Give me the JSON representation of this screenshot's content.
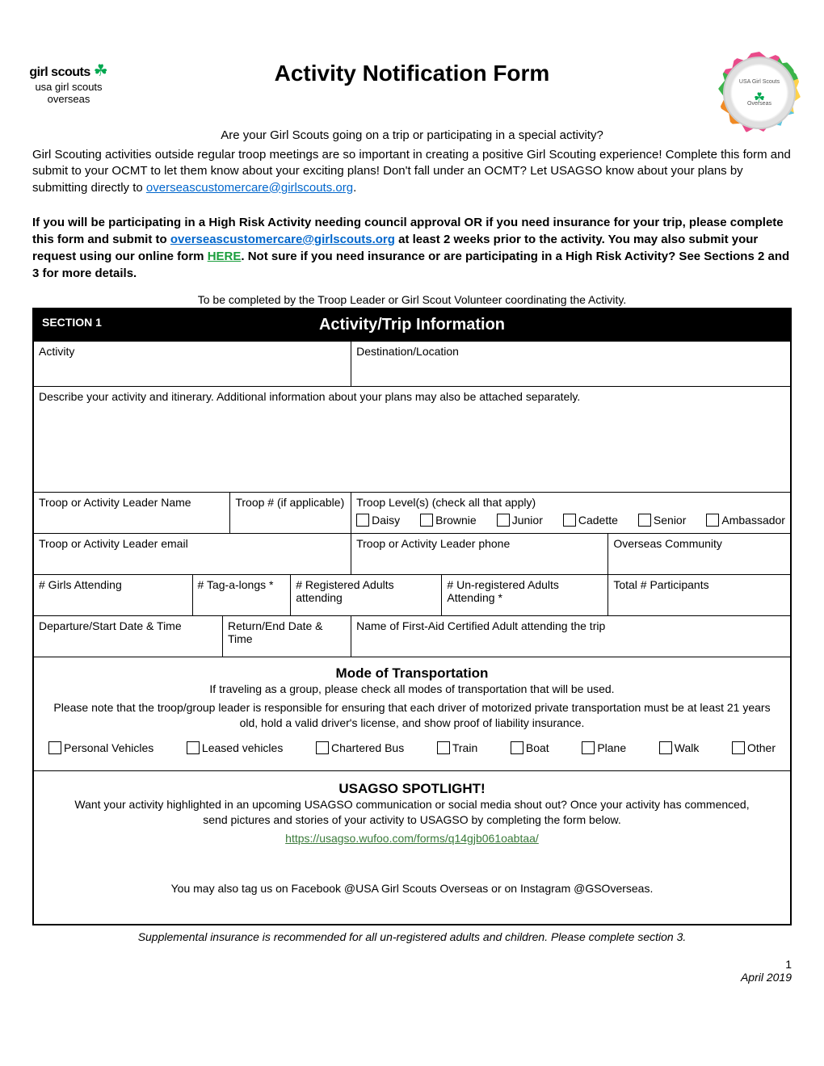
{
  "logo": {
    "line1": "girl scouts",
    "line2": "usa girl scouts",
    "line3": "overseas"
  },
  "badge": {
    "top": "USA Girl Scouts",
    "bottom": "Overseas"
  },
  "title": "Activity Notification Form",
  "subtitle": "Are your Girl Scouts going on a trip or participating in a special activity?",
  "intro": {
    "p1": "Girl Scouting activities outside regular troop meetings are so important in creating a positive Girl Scouting experience!  Complete this form and submit to your OCMT to let them know about your exciting plans!  Don't fall under an OCMT?  Let USAGSO know about your plans by submitting directly to ",
    "email": "overseascustomercare@girlscouts.org",
    "p1_end": "."
  },
  "bold": {
    "a": "If you will be participating in a High Risk Activity needing council approval OR if you need insurance for your trip, please complete this form and submit to ",
    "email": "overseascustomercare@girlscouts.org",
    "b": " at least 2 weeks prior to the activity.  You may also submit your request using our online form ",
    "here": "HERE",
    "c": ".  Not sure if you need insurance or are participating in a High Risk Activity?  See Sections 2 and 3 for more details."
  },
  "completed_by": "To be completed by the Troop Leader or Girl Scout Volunteer coordinating the Activity.",
  "section1": {
    "label": "SECTION 1",
    "title": "Activity/Trip Information",
    "activity": "Activity",
    "destination": "Destination/Location",
    "describe": "Describe your activity and itinerary.  Additional information about your plans may also be attached separately.",
    "leader_name": "Troop or Activity Leader Name",
    "troop_num": "Troop # (if applicable)",
    "troop_level": "Troop Level(s) (check all that apply)",
    "levels": [
      "Daisy",
      "Brownie",
      "Junior",
      "Cadette",
      "Senior",
      "Ambassador"
    ],
    "leader_email": "Troop or Activity Leader email",
    "leader_phone": "Troop or Activity Leader phone",
    "community": "Overseas Community",
    "girls": "# Girls Attending",
    "tag": "# Tag-a-longs *",
    "reg_adults": "# Registered Adults attending",
    "unreg_adults": "# Un-registered Adults Attending *",
    "total": "Total # Participants",
    "depart": "Departure/Start Date & Time",
    "return": "Return/End Date & Time",
    "firstaid": "Name of First-Aid Certified Adult attending the trip"
  },
  "transport": {
    "title": "Mode of Transportation",
    "line1": "If traveling as a group, please check all modes of transportation that will be used.",
    "line2": "Please note that the troop/group leader is responsible for ensuring that each driver of motorized private transportation must be at least 21 years old, hold a valid driver's license, and show proof of liability insurance.",
    "modes": [
      "Personal Vehicles",
      "Leased vehicles",
      "Chartered Bus",
      "Train",
      "Boat",
      "Plane",
      "Walk",
      "Other"
    ]
  },
  "spotlight": {
    "title": "USAGSO SPOTLIGHT!",
    "body": "Want your activity highlighted in an upcoming USAGSO communication or social media shout out?  Once your activity has commenced, send pictures and stories of your activity to USAGSO by completing the form below.",
    "url": "https://usagso.wufoo.com/forms/q14gjb061oabtaa/",
    "tag": "You may also tag us on Facebook @USA Girl Scouts Overseas or on Instagram @GSOverseas."
  },
  "supp_note": "Supplemental insurance is recommended for all un-registered adults and children.  Please complete section 3.",
  "footer": {
    "page": "1",
    "date": "April 2019"
  }
}
